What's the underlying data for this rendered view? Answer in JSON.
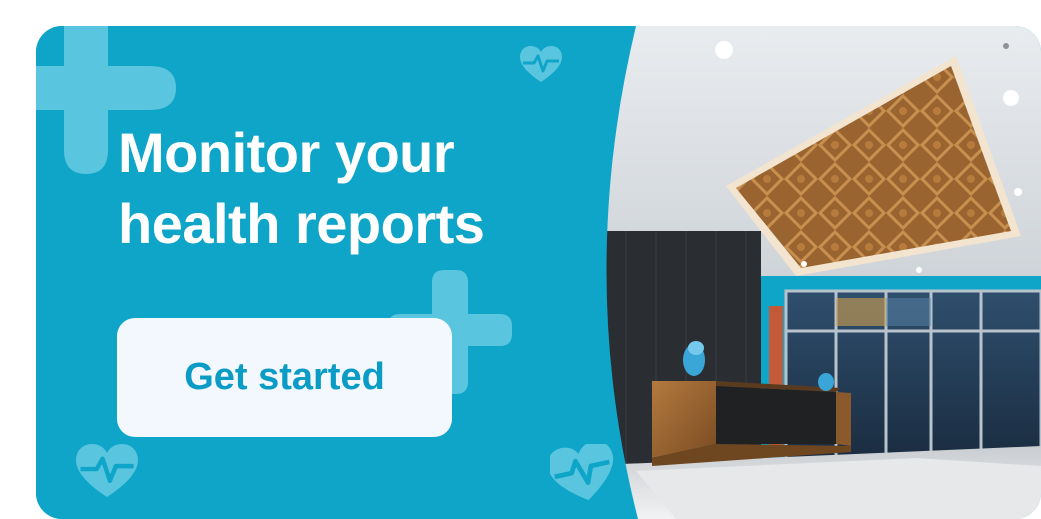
{
  "banner": {
    "headline_line1": "Monitor your",
    "headline_line2": "health reports",
    "cta_label": "Get started"
  },
  "colors": {
    "panel_blue": "#0ea5c9",
    "decor_light": "#59c5de",
    "button_bg": "#f3f8ff",
    "button_text": "#0a9cc4",
    "headline": "#ffffff"
  },
  "icons": [
    "plus-icon",
    "heartbeat-icon"
  ],
  "image": "hospital-lobby-photo"
}
